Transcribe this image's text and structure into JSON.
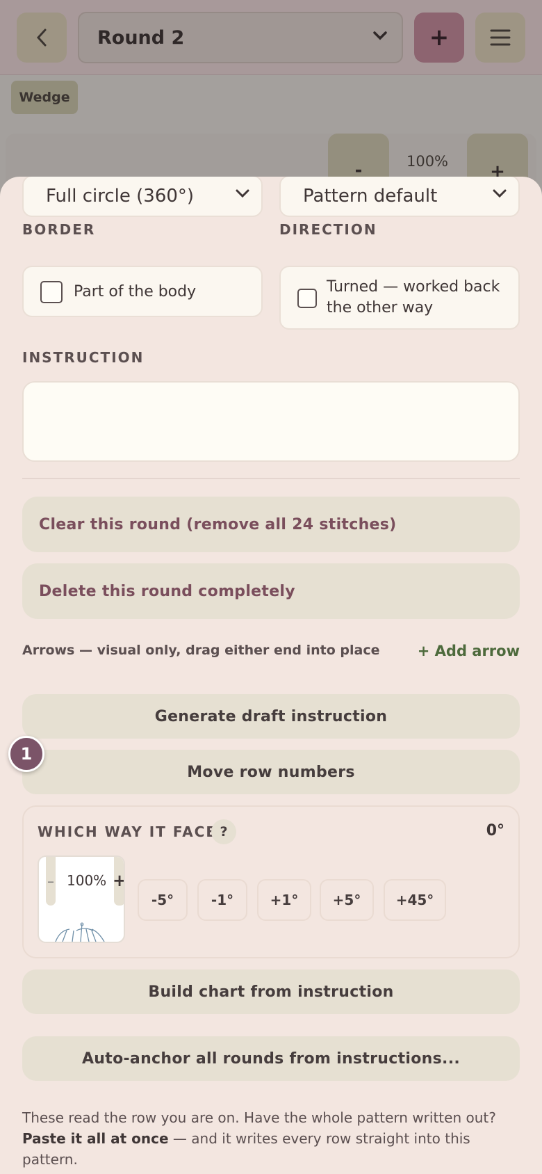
{
  "header": {
    "round_select": "Round 2",
    "add_label": "+"
  },
  "canvas": {
    "chip": "Wedge",
    "zoom_minus": "-",
    "zoom_value": "100%",
    "zoom_plus": "+"
  },
  "sheet": {
    "shape_select": "Full circle (360°)",
    "style_select": "Pattern default",
    "border_label": "BORDER",
    "border_checkbox": "Part of the body",
    "direction_label": "DIRECTION",
    "direction_checkbox": "Turned — worked back the other way",
    "instruction_label": "INSTRUCTION",
    "instruction_value": "",
    "clear_round": "Clear this round (remove all 24 stitches)",
    "delete_round": "Delete this round completely",
    "arrows_note": "Arrows — visual only, drag either end into place",
    "add_arrow": "+ Add arrow",
    "generate_draft": "Generate draft instruction",
    "move_row_numbers": "Move row numbers",
    "step_badge": "1",
    "faces": {
      "title": "WHICH WAY IT FACES",
      "help": "?",
      "degrees": "0°",
      "preview_minus": "–",
      "preview_zoom": "100%",
      "preview_plus": "+",
      "rotations": [
        "-5°",
        "-1°",
        "+1°",
        "+5°",
        "+45°"
      ]
    },
    "build_chart": "Build chart from instruction",
    "auto_anchor": "Auto-anchor all rounds from instructions...",
    "footer_text_1": "These read the row you are on. Have the whole pattern written out?",
    "footer_bold": "Paste it all at once",
    "footer_text_2": " — and it writes every row straight into this pattern."
  },
  "colors": {
    "accent": "#7b5468",
    "danger_text": "#7a4e5c",
    "link_green": "#4d6a3c",
    "sheet_bg": "#f3e6e0"
  }
}
